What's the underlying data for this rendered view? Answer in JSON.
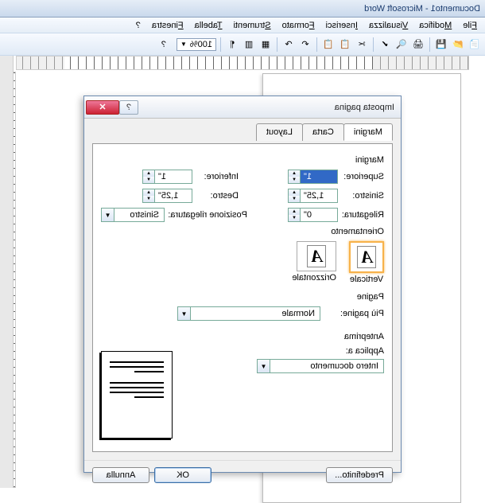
{
  "app": {
    "title": "Documento1 - Microsoft Word"
  },
  "menu": {
    "file": "File",
    "edit": "Modifica",
    "view": "Visualizza",
    "insert": "Inserisci",
    "format": "Formato",
    "tools": "Strumenti",
    "table": "Tabella",
    "window": "Finestra",
    "help": "?"
  },
  "toolbar": {
    "zoom": "100%"
  },
  "icons": {
    "new": "📄",
    "open": "📂",
    "save": "💾",
    "print": "🖨",
    "preview": "🔍",
    "spell": "✔",
    "cut": "✂",
    "copy": "📋",
    "paste": "📋",
    "undo": "↶",
    "redo": "↷",
    "table": "▦",
    "cols": "▥",
    "para": "¶",
    "help": "?",
    "arrow": "▼",
    "up": "▲",
    "dn": "▼"
  },
  "dialog": {
    "title": "Imposta pagina",
    "tabs": {
      "margins": "Margini",
      "paper": "Carta",
      "layout": "Layout"
    },
    "margins": {
      "group": "Margini",
      "top_label": "Superiore:",
      "top_value": "1\"",
      "bottom_label": "Inferiore:",
      "bottom_value": "1\"",
      "left_label": "Sinistro:",
      "left_value": "1,25\"",
      "right_label": "Destro:",
      "right_value": "1,25\"",
      "gutter_label": "Rilegatura:",
      "gutter_value": "0\"",
      "gutter_pos_label": "Posizione rilegatura:",
      "gutter_pos_value": "Sinistro"
    },
    "orientation": {
      "group": "Orientamento",
      "portrait": "Verticale",
      "landscape": "Orizzontale"
    },
    "pages": {
      "group": "Pagine",
      "multi_label": "Più pagine:",
      "multi_value": "Normale"
    },
    "preview": {
      "group": "Anteprima",
      "apply_label": "Applica a:",
      "apply_value": "Intero documento"
    },
    "buttons": {
      "default": "Predefinito...",
      "ok": "OK",
      "cancel": "Annulla"
    }
  }
}
